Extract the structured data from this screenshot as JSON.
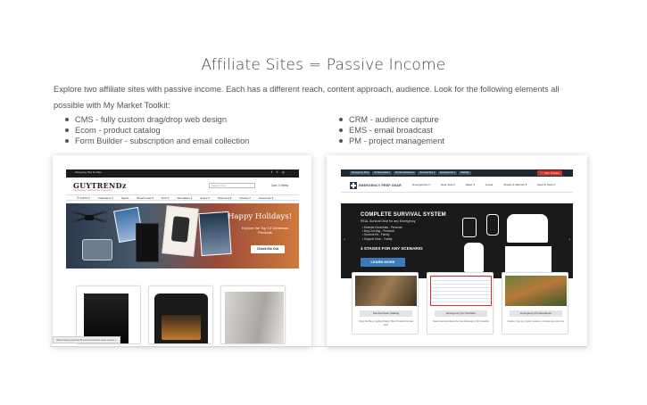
{
  "page": {
    "title": "Affiliate Sites = Passive Income",
    "intro": "Explore two affiliate sites with passive income. Each has a different reach, content approach, audience. Look for the following elements all possible with My Market Toolkit:",
    "features_left": [
      "CMS - fully custom drag/drop web design",
      "Ecom - product catalog",
      "Form Builder - subscription and email collection"
    ],
    "features_right": [
      "CRM - audience capture",
      "EMS - email broadcast",
      "PM - project management"
    ]
  },
  "guytrendz": {
    "top_bar_text": "Shopping Tips for Men",
    "social_icons": "f  t  ◎",
    "logo": "GUYTRENDz",
    "logo_sub": "TRENDING PRODUCTS FOR MEN",
    "search_placeholder": "Search here",
    "cart": "Cart - 0 Items",
    "nav": [
      "☰ GIFTS ▾",
      "Collections ▾",
      "Sports",
      "Brew/Cooks ▾",
      "Tech ▾",
      "Wearables ▾",
      "Active ▾",
      "Operators ▾",
      "Novelty ▾",
      "Seasonals ▾"
    ],
    "hero_title": "Happy Holidays!",
    "hero_text": "Explore the Top 10 Christmas Products",
    "hero_button": "Check Em Out",
    "status_url": "https://www.guytrendz.com/microsoft-xbox-series-x"
  },
  "emergency": {
    "top_tabs": [
      "Emergency Prep",
      "Kit Essentials ▾",
      "Product Reviews ▾",
      "Survival Tips ▾",
      "Emergencies ▾",
      "Website"
    ],
    "cart": "🛒 Cart: 0 items",
    "logo_name": "EMERGENCY PREP GEAR",
    "nav": [
      "Emergencies ▾",
      "Gear Sets ▾",
      "Water ▾",
      "Foods",
      "Shelter & Warmth ▾",
      "Gear & Tools ▾"
    ],
    "hero_title": "COMPLETE SURVIVAL SYSTEM",
    "hero_subtitle": "REAL Survival Gear for any Emergency",
    "hero_list": [
      "• Modular Essentials - Personal",
      "• Bug Out Bag - Personal",
      "• Survival Kit - Family",
      "• Support Gear - Family"
    ],
    "hero_stages": "4 STAGES FOR ANY SCENARIO",
    "hero_button": "LEARN MORE",
    "cards": [
      {
        "button": "Survival Gear Catalog",
        "desc": "Shop the Best, Highest Rated, Most Trusted Survival Gear"
      },
      {
        "button": "Emergency Kit Checklist",
        "desc": "Select and download the best Emergency Kit checklist"
      },
      {
        "button": "Emergency Preparedness",
        "desc": "Guides, how-to, product reviews, survival tips and more"
      }
    ]
  }
}
